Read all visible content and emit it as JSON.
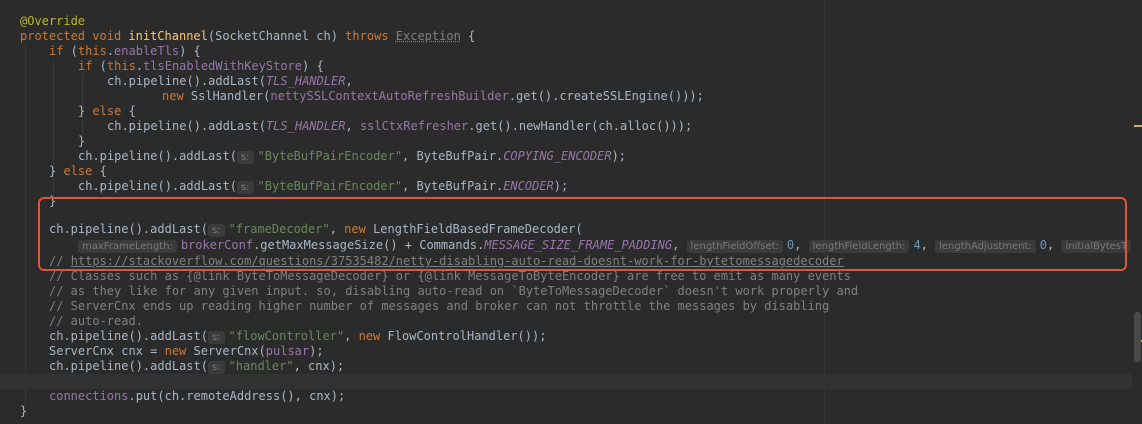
{
  "editor": {
    "code": {
      "l1": {
        "annotation": "@Override"
      },
      "l2": {
        "kw_protected": "protected",
        "kw_void": "void",
        "method": "initChannel",
        "params": "(SocketChannel ch) ",
        "kw_throws": "throws",
        "exception": "Exception",
        "tail": " {"
      },
      "l3": {
        "kw_if": "if",
        "open": " (",
        "kw_this": "this",
        "dot": ".",
        "field": "enableTls",
        "tail": ") {"
      },
      "l4": {
        "kw_if": "if",
        "open": " (",
        "kw_this": "this",
        "dot": ".",
        "field": "tlsEnabledWithKeyStore",
        "tail": ") {"
      },
      "l5": {
        "pre": "ch.pipeline().addLast(",
        "const": "TLS_HANDLER",
        "tail": ","
      },
      "l6": {
        "kw_new": "new",
        "mid": " SslHandler(",
        "field": "nettySSLContextAutoRefreshBuilder",
        "tail": ".get().createSSLEngine()));"
      },
      "l7": {
        "pre": "} ",
        "kw_else": "else",
        "tail": " {"
      },
      "l8": {
        "pre": "ch.pipeline().addLast(",
        "const": "TLS_HANDLER",
        "comma": ", ",
        "field": "sslCtxRefresher",
        "tail": ".get().newHandler(ch.alloc()));"
      },
      "l9": {
        "text": "}"
      },
      "l10": {
        "pre": "ch.pipeline().addLast(",
        "hint": "s:",
        "str": "\"ByteBufPairEncoder\"",
        "mid": ", ByteBufPair.",
        "const": "COPYING_ENCODER",
        "tail": ");"
      },
      "l11": {
        "pre": "} ",
        "kw_else": "else",
        "tail": " {"
      },
      "l12": {
        "pre": "ch.pipeline().addLast(",
        "hint": "s:",
        "str": "\"ByteBufPairEncoder\"",
        "mid": ", ByteBufPair.",
        "const": "ENCODER",
        "tail": ");"
      },
      "l13": {
        "text": "}"
      },
      "l14": {
        "pre": "ch.pipeline().addLast(",
        "hint": "s:",
        "str": "\"frameDecoder\"",
        "comma": ", ",
        "kw_new": "new",
        "tail": " LengthFieldBasedFrameDecoder("
      },
      "l15": {
        "hint1": "maxFrameLength:",
        "field": "brokerConf",
        "mid": ".getMaxMessageSize() + Commands.",
        "const": "MESSAGE_SIZE_FRAME_PADDING",
        "comma1": ", ",
        "hint2": "lengthFieldOffset:",
        "num2": "0",
        "comma2": ", ",
        "hint3": "lengthFieldLength:",
        "num3": "4",
        "comma3": ", ",
        "hint4": "lengthAdjustment:",
        "num4": "0",
        "comma4": ", ",
        "hint5": "initialBytesT"
      },
      "l16": {
        "pre": "// ",
        "link": "https://stackoverflow.com/questions/37535482/netty-disabling-auto-read-doesnt-work-for-bytetomessagedecoder"
      },
      "l17": {
        "text": "// Classes such as {@link ByteToMessageDecoder} or {@link MessageToByteEncoder} are free to emit as many events"
      },
      "l18": {
        "text": "// as they like for any given input. so, disabling auto-read on `ByteToMessageDecoder` doesn't work properly and"
      },
      "l19": {
        "text": "// ServerCnx ends up reading higher number of messages and broker can not throttle the messages by disabling"
      },
      "l20": {
        "text": "// auto-read."
      },
      "l21": {
        "pre": "ch.pipeline().addLast(",
        "hint": "s:",
        "str": "\"flowController\"",
        "comma": ", ",
        "kw_new": "new",
        "tail": " FlowControlHandler());"
      },
      "l22": {
        "pre": "ServerCnx cnx = ",
        "kw_new": "new",
        "tail": " ServerCnx(",
        "field": "pulsar",
        "end": ");"
      },
      "l23": {
        "pre": "ch.pipeline().addLast(",
        "hint": "s:",
        "str": "\"handler\"",
        "tail": ", cnx);"
      },
      "l25": {
        "field": "connections",
        "tail": ".put(ch.remoteAddress(), cnx);"
      },
      "l26": {
        "text": "}"
      }
    }
  },
  "colors": {
    "background": "#2b2b2b",
    "keyword": "#cc7832",
    "annotation": "#bbb529",
    "method": "#ffc66d",
    "field": "#9876aa",
    "string": "#6a8759",
    "number": "#6897bb",
    "comment": "#808080",
    "highlight_box": "#e8512e"
  }
}
